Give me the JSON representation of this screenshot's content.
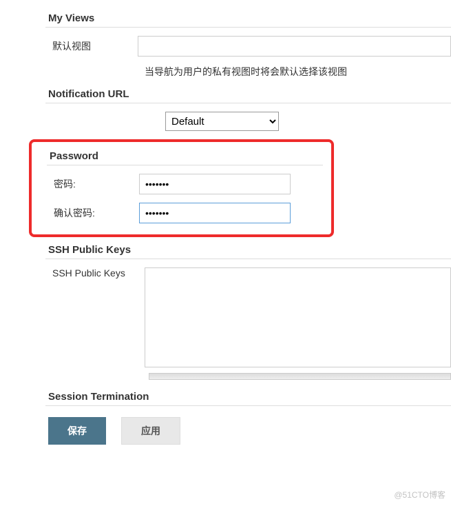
{
  "sections": {
    "myViews": {
      "header": "My Views",
      "defaultViewLabel": "默认视图",
      "defaultViewValue": "",
      "helpText": "当导航为用户的私有视图时将会默认选择该视图"
    },
    "notificationUrl": {
      "header": "Notification URL",
      "selectValue": "Default"
    },
    "password": {
      "header": "Password",
      "passwordLabel": "密码:",
      "passwordValue": "•••••••",
      "confirmLabel": "确认密码:",
      "confirmValue": "•••••••"
    },
    "sshKeys": {
      "header": "SSH Public Keys",
      "label": "SSH Public Keys",
      "value": ""
    },
    "sessionTermination": {
      "header": "Session Termination"
    }
  },
  "buttons": {
    "save": "保存",
    "apply": "应用"
  },
  "watermark": "@51CTO博客"
}
